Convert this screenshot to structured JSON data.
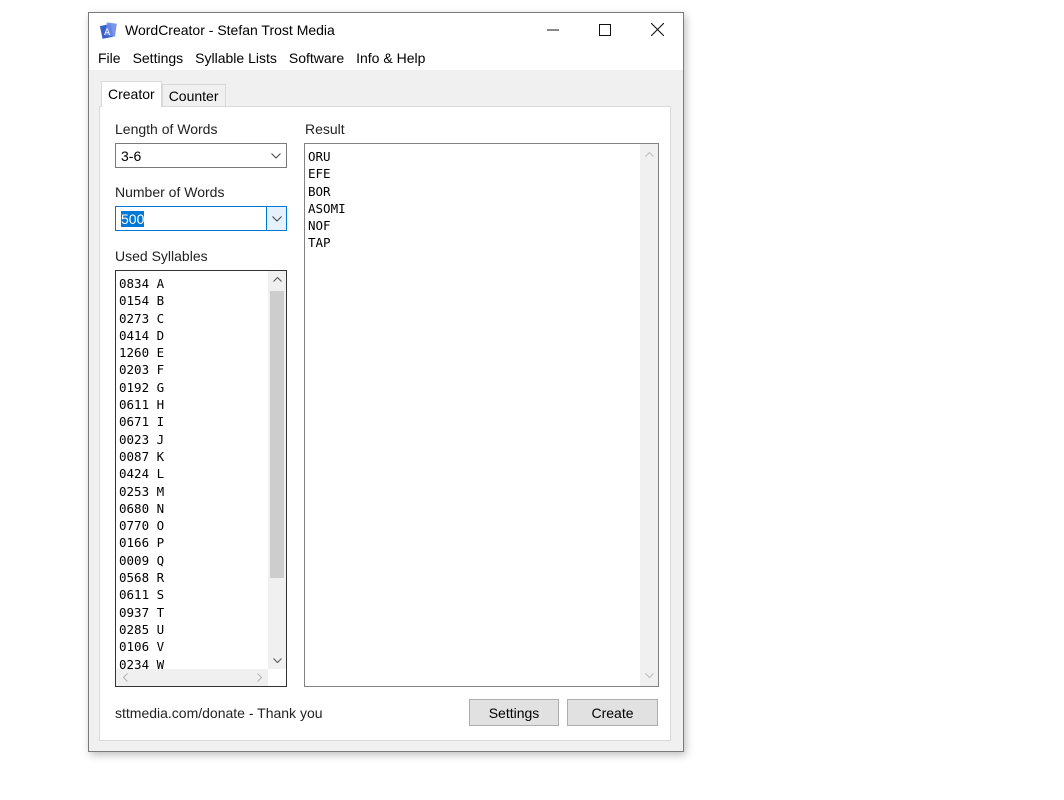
{
  "window": {
    "title": "WordCreator - Stefan Trost Media",
    "controls": {
      "minimize": "—",
      "maximize": "☐",
      "close": "✕"
    }
  },
  "menu": [
    "File",
    "Settings",
    "Syllable Lists",
    "Software",
    "Info & Help"
  ],
  "tabs": [
    {
      "label": "Creator",
      "active": true
    },
    {
      "label": "Counter",
      "active": false
    }
  ],
  "creator": {
    "length_label": "Length of Words",
    "length_value": "3-6",
    "number_label": "Number of Words",
    "number_value": "500",
    "syllables_label": "Used Syllables",
    "syllables": [
      {
        "count": "0834",
        "syl": "A"
      },
      {
        "count": "0154",
        "syl": "B"
      },
      {
        "count": "0273",
        "syl": "C"
      },
      {
        "count": "0414",
        "syl": "D"
      },
      {
        "count": "1260",
        "syl": "E"
      },
      {
        "count": "0203",
        "syl": "F"
      },
      {
        "count": "0192",
        "syl": "G"
      },
      {
        "count": "0611",
        "syl": "H"
      },
      {
        "count": "0671",
        "syl": "I"
      },
      {
        "count": "0023",
        "syl": "J"
      },
      {
        "count": "0087",
        "syl": "K"
      },
      {
        "count": "0424",
        "syl": "L"
      },
      {
        "count": "0253",
        "syl": "M"
      },
      {
        "count": "0680",
        "syl": "N"
      },
      {
        "count": "0770",
        "syl": "O"
      },
      {
        "count": "0166",
        "syl": "P"
      },
      {
        "count": "0009",
        "syl": "Q"
      },
      {
        "count": "0568",
        "syl": "R"
      },
      {
        "count": "0611",
        "syl": "S"
      },
      {
        "count": "0937",
        "syl": "T"
      },
      {
        "count": "0285",
        "syl": "U"
      },
      {
        "count": "0106",
        "syl": "V"
      },
      {
        "count": "0234",
        "syl": "W"
      }
    ],
    "result_label": "Result",
    "results": [
      "ORU",
      "EFE",
      "BOR",
      "ASOMI",
      "NOF",
      "TAP"
    ],
    "donate_text": "sttmedia.com/donate - Thank you",
    "settings_button": "Settings",
    "create_button": "Create"
  }
}
